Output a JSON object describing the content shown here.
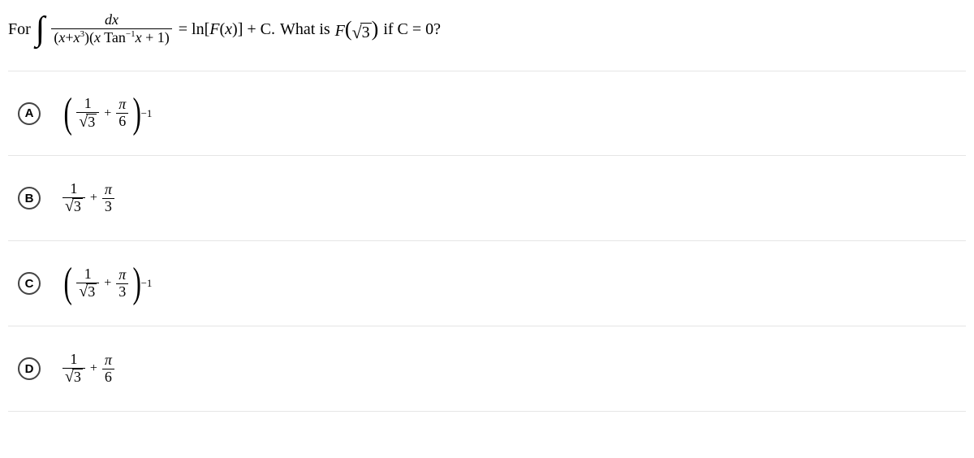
{
  "question": {
    "prefix": "For",
    "int_num": "dx",
    "int_den_left": "x",
    "int_den_plus": "+",
    "int_den_x3_base": "x",
    "int_den_x3_exp": "3",
    "int_den_right_x": "x",
    "int_den_tan": " Tan",
    "int_den_tan_exp": "−1",
    "int_den_right_tail": "x",
    "int_den_plus1": "+ 1",
    "eq": "= ln",
    "lb": "[",
    "F": "F",
    "fx_open": "(",
    "fx_x": "x",
    "fx_close": ")",
    "rb": "]",
    "plusC": "+ C",
    "dot": ".",
    "what": " What is ",
    "F2": "F",
    "paren_open": "(",
    "sqrt_arg": "3",
    "paren_close": ")",
    "ifC": " if C = 0?"
  },
  "options": {
    "A": {
      "letter": "A",
      "one": "1",
      "sqrt3": "3",
      "plus": "+",
      "pi": "π",
      "six": "6",
      "exp": "−1"
    },
    "B": {
      "letter": "B",
      "one": "1",
      "sqrt3": "3",
      "plus": "+",
      "pi": "π",
      "three": "3"
    },
    "C": {
      "letter": "C",
      "one": "1",
      "sqrt3": "3",
      "plus": "+",
      "pi": "π",
      "three": "3",
      "exp": "−1"
    },
    "D": {
      "letter": "D",
      "one": "1",
      "sqrt3": "3",
      "plus": "+",
      "pi": "π",
      "six": "6"
    }
  }
}
